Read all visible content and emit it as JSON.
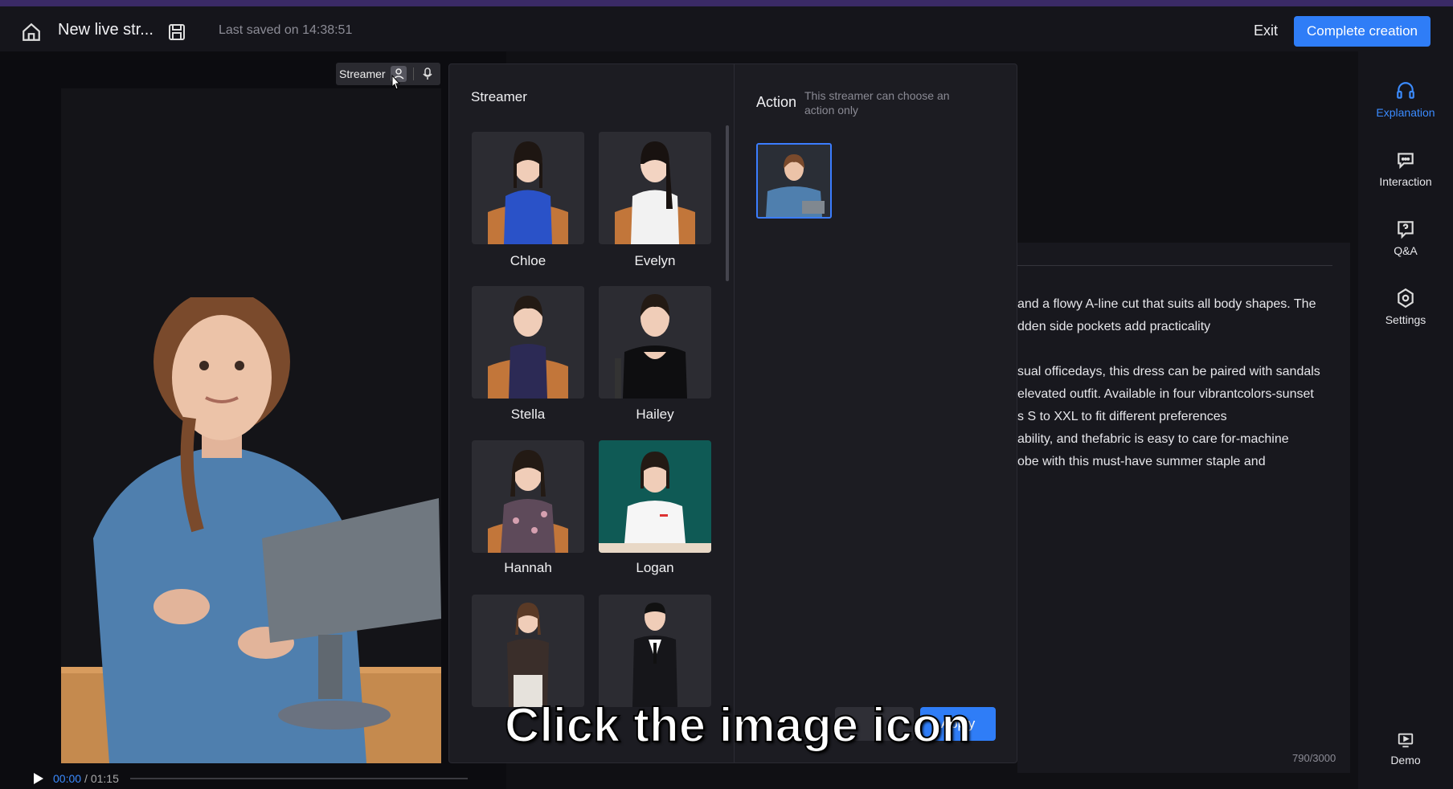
{
  "topbar": {
    "title": "New live str...",
    "saved": "Last saved on 14:38:51",
    "exit": "Exit",
    "complete": "Complete creation"
  },
  "preview": {
    "chip_label": "Streamer",
    "time_current": "00:00",
    "time_total": "/ 01:15"
  },
  "panel": {
    "streamer_title": "Streamer",
    "action_title": "Action",
    "action_note": "This streamer can choose an action only",
    "streamers": [
      {
        "name": "Chloe"
      },
      {
        "name": "Evelyn"
      },
      {
        "name": "Stella"
      },
      {
        "name": "Hailey"
      },
      {
        "name": "Hannah"
      },
      {
        "name": "Logan"
      },
      {
        "name": ""
      },
      {
        "name": ""
      }
    ],
    "apply": "Apply"
  },
  "editor": {
    "lines": [
      "and a flowy A-line cut that suits all body shapes. The",
      "dden side pockets add practicality",
      "sual officedays, this dress can be paired with sandals",
      "elevated outfit. Available in four vibrantcolors-sunset",
      "s S to XXL to fit different preferences",
      "ability, and thefabric is easy to care for-machine",
      "obe with this must-have summer staple and"
    ],
    "count": "790/3000"
  },
  "nav": {
    "explanation": "Explanation",
    "interaction": "Interaction",
    "qa": "Q&A",
    "settings": "Settings",
    "demo": "Demo"
  },
  "caption": "Click the image icon",
  "colors": {
    "accent": "#2f7df7",
    "panel": "#1c1c22",
    "background": "#101014"
  }
}
